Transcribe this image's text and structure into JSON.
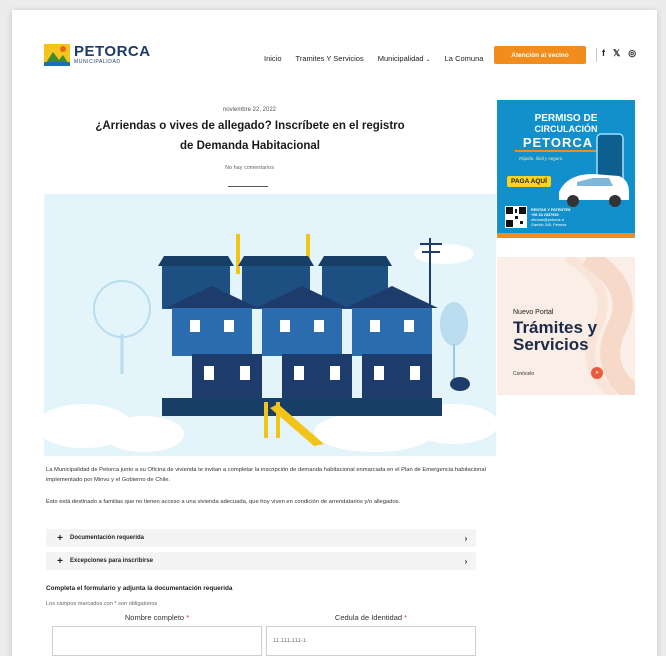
{
  "header": {
    "logo_name": "PETORCA",
    "logo_sub": "MUNICIPALIDAD",
    "nav": [
      "Inicio",
      "Tramites Y Servicios",
      "Municipalidad",
      "La Comuna"
    ],
    "nav_dropdown_marker": "⌄",
    "cta_label": "Atención al vecino",
    "social": [
      "f",
      "𝕏",
      "◎"
    ]
  },
  "article": {
    "date": "noviembre 22, 2022",
    "title": "¿Arriendas o vives de allegado? Inscríbete en el registro de Demanda Habitacional",
    "comments": "No hay comentarios",
    "paragraph1": "La Municipalidad de Petorca junto a su Oficina de vivienda te invitan a completar la inscripción de demanda habitacional enmarcada en el Plan de Emergencia habitacional implementado por Minvu y el Gobierno de Chile.",
    "paragraph2": "Esto está destinado a familias que no tienen acceso a una vivienda adecuada, que hoy viven en condición de arrendatarios y/o allegados.",
    "accordions": [
      {
        "label": "Documentación requerida"
      },
      {
        "label": "Excepciones para inscribirse"
      }
    ]
  },
  "form": {
    "title": "Completa el formulario y adjunta la documentación requerida",
    "note": "Los campos marcados con * son obligatorios",
    "field_name_label": "Nombre completo",
    "field_rut_label": "Cedula de Identidad",
    "required_mark": "*",
    "field_rut_placeholder": "11.111.111-1"
  },
  "sidebar": {
    "ad1": {
      "title_line1": "PERMISO DE",
      "title_line2": "CIRCULACIÓN",
      "brand": "PETORCA",
      "tagline": "Rápido, fácil y seguro",
      "pay_label": "PAGA AQUÍ",
      "contact": [
        "RENTAS Y PATENTES",
        "+56 33 2337939",
        "oficinas@petorca.cl",
        "Garrido 345, Petorca"
      ]
    },
    "ad2": {
      "kicker": "Nuevo Portal",
      "headline1": "Trámites y",
      "headline2": "Servicios",
      "cta": "Conócelo",
      "arrow": "»"
    }
  },
  "colors": {
    "accent": "#f28c1c",
    "brand_blue": "#1d3b6b",
    "ad_blue": "#1190cc",
    "hero_bg": "#e4f4fb"
  }
}
